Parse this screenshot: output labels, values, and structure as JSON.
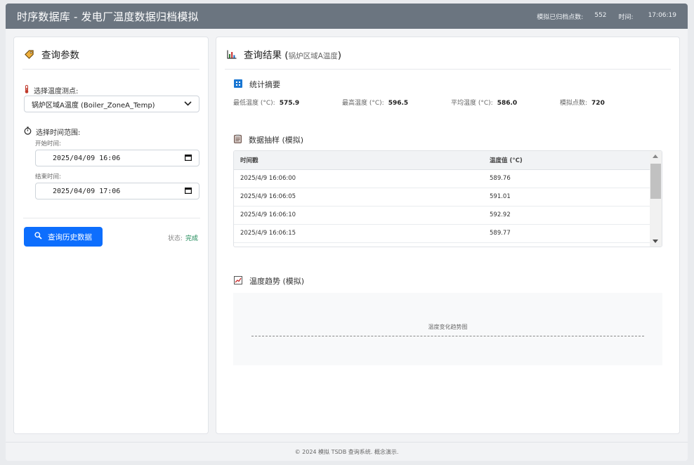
{
  "header": {
    "title": "时序数据库 - 发电厂温度数据归档模拟",
    "archived_label": "模拟已归档点数:",
    "archived_count": "552",
    "time_label": "时间:",
    "time_value": "17:06:19"
  },
  "query_panel": {
    "title": "查询参数",
    "point_label": "选择温度测点:",
    "point_selected": "锅炉区域A温度 (Boiler_ZoneA_Temp)",
    "range_label": "选择时间范围:",
    "start_label": "开始时间:",
    "start_value": "2025/04/09 16:06",
    "end_label": "结束时间:",
    "end_value": "2025/04/09 17:06",
    "query_button": "查询历史数据",
    "status_label": "状态:",
    "status_value": "完成"
  },
  "results_panel": {
    "title": "查询结果",
    "title_paren_open": "(",
    "title_point": "锅炉区域A温度",
    "title_paren_close": ")",
    "summary_title": "统计摘要",
    "stats": [
      {
        "label": "最低温度 (°C):",
        "value": "575.9"
      },
      {
        "label": "最高温度 (°C):",
        "value": "596.5"
      },
      {
        "label": "平均温度 (°C):",
        "value": "586.0"
      },
      {
        "label": "模拟点数:",
        "value": "720"
      }
    ],
    "sample_title": "数据抽样 (模拟)",
    "table": {
      "headers": [
        "时间戳",
        "温度值 (°C)"
      ],
      "rows": [
        [
          "2025/4/9 16:06:00",
          "589.76"
        ],
        [
          "2025/4/9 16:06:05",
          "591.01"
        ],
        [
          "2025/4/9 16:06:10",
          "592.92"
        ],
        [
          "2025/4/9 16:06:15",
          "589.77"
        ]
      ]
    },
    "trend_title": "温度趋势 (模拟)",
    "trend_placeholder": "温度变化趋势图"
  },
  "footer": {
    "text": "© 2024 模拟 TSDB 查询系统. 概念演示."
  },
  "colors": {
    "header_bg": "#6b7580",
    "primary": "#0d6efd",
    "success": "#198754"
  }
}
